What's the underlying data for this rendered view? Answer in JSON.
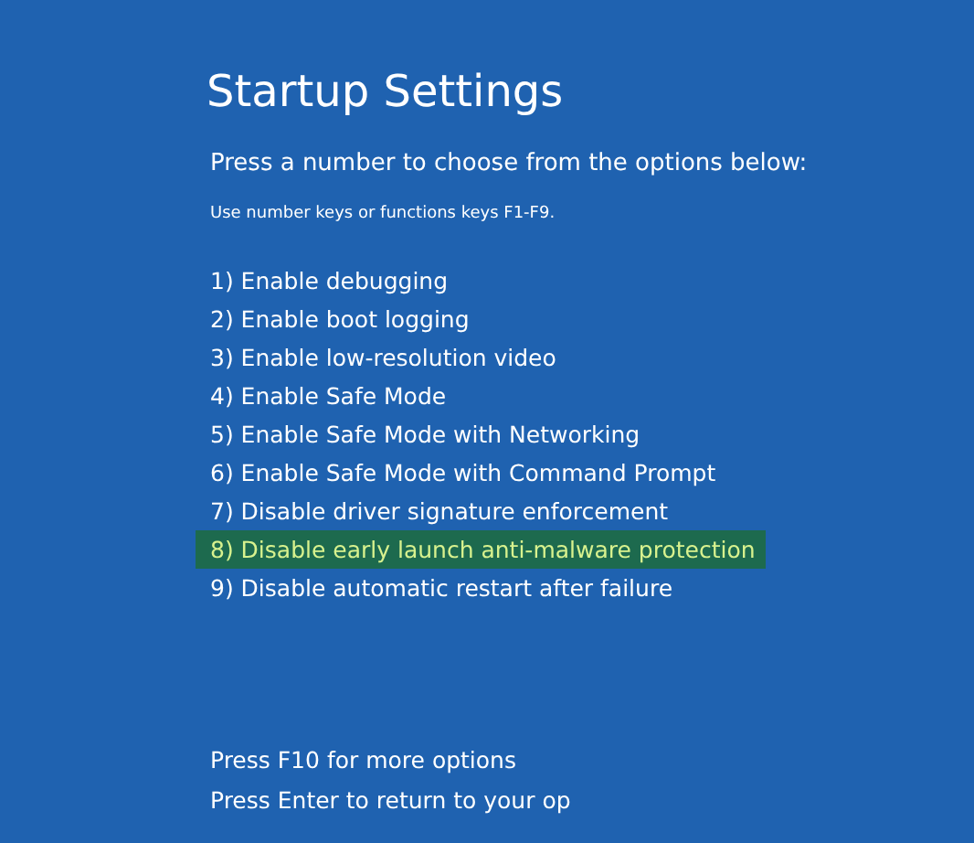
{
  "title": "Startup Settings",
  "prompt": "Press a number to choose from the options below:",
  "hint": "Use number keys or functions keys F1-F9.",
  "options": [
    {
      "label": "1) Enable debugging",
      "selected": false
    },
    {
      "label": "2) Enable boot logging",
      "selected": false
    },
    {
      "label": "3) Enable low-resolution video",
      "selected": false
    },
    {
      "label": "4) Enable Safe Mode",
      "selected": false
    },
    {
      "label": "5) Enable Safe Mode with Networking",
      "selected": false
    },
    {
      "label": "6) Enable Safe Mode with Command Prompt",
      "selected": false
    },
    {
      "label": "7) Disable driver signature enforcement",
      "selected": false
    },
    {
      "label": "8) Disable early launch anti-malware protection",
      "selected": true
    },
    {
      "label": "9) Disable automatic restart after failure",
      "selected": false
    }
  ],
  "footer": [
    "Press F10 for more options",
    "Press Enter to return to your op"
  ]
}
